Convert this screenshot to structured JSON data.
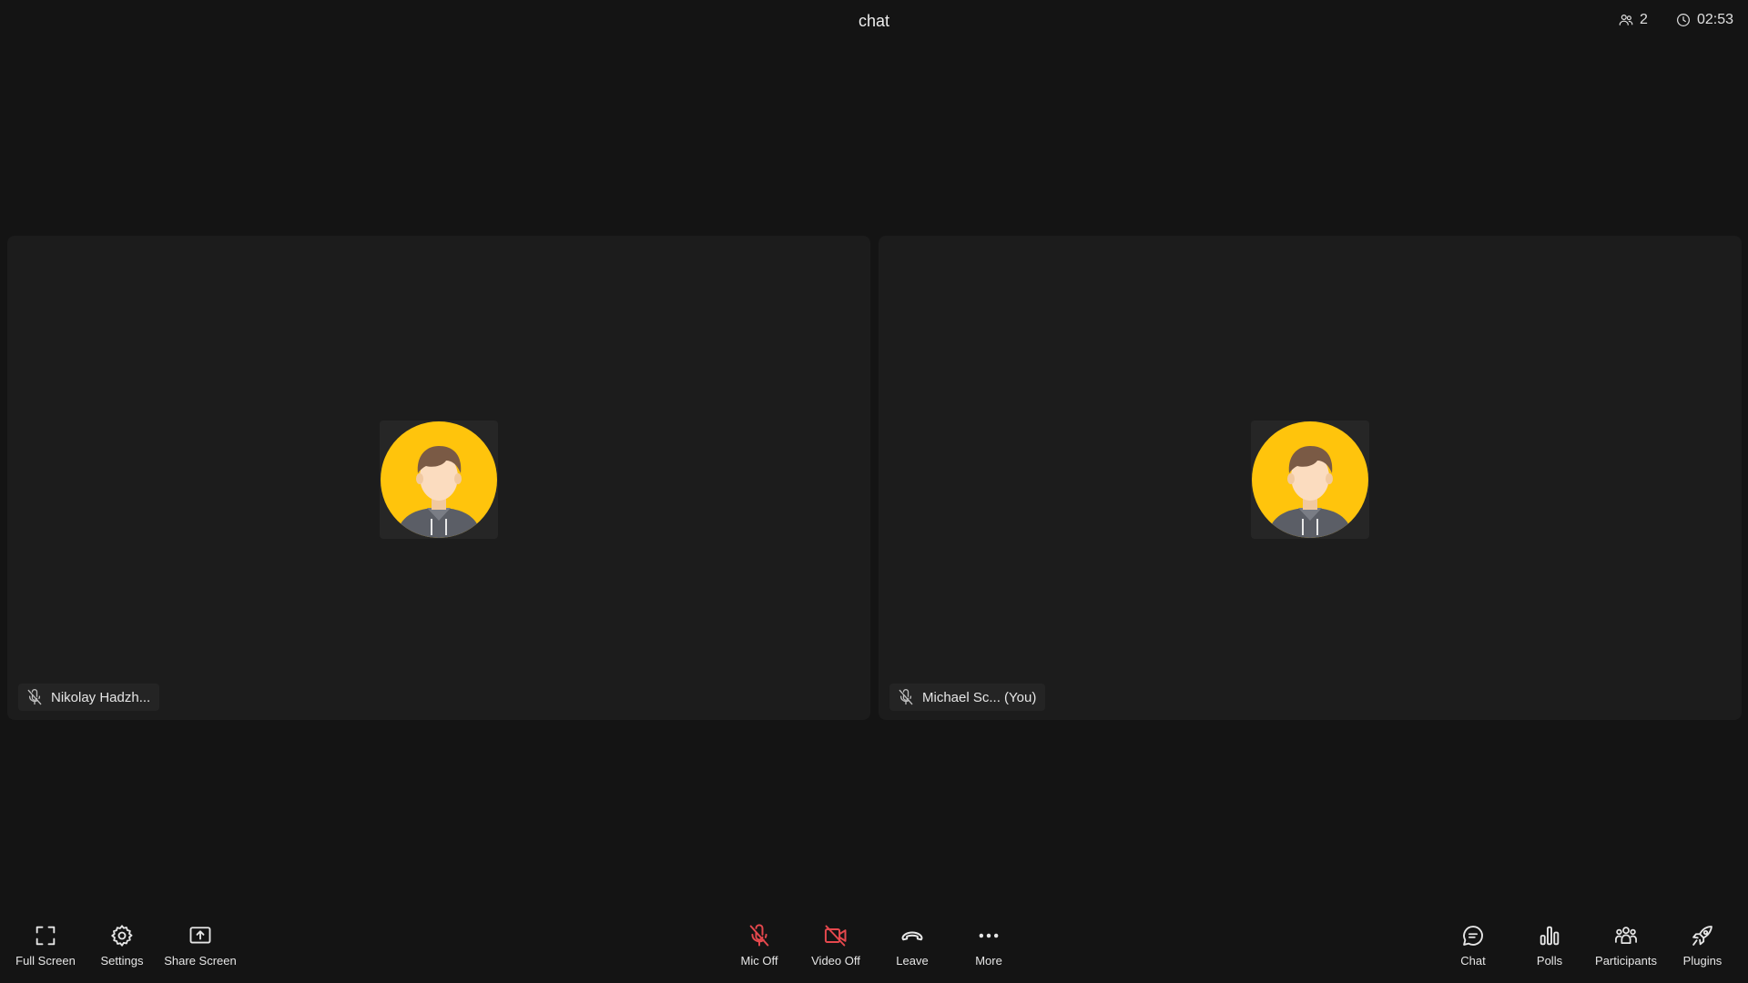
{
  "header": {
    "title": "chat",
    "participant_count": "2",
    "timer": "02:53"
  },
  "tiles": [
    {
      "name": "Nikolay Hadzh...",
      "mic": "muted"
    },
    {
      "name": "Michael Sc... (You)",
      "mic": "muted"
    }
  ],
  "toolbar": {
    "left": [
      {
        "label": "Full Screen",
        "icon": "fullscreen-icon"
      },
      {
        "label": "Settings",
        "icon": "gear-icon"
      },
      {
        "label": "Share Screen",
        "icon": "share-screen-icon"
      }
    ],
    "center": [
      {
        "label": "Mic Off",
        "icon": "mic-off-icon"
      },
      {
        "label": "Video Off",
        "icon": "video-off-icon"
      },
      {
        "label": "Leave",
        "icon": "phone-hangup-icon"
      },
      {
        "label": "More",
        "icon": "ellipsis-icon"
      }
    ],
    "right": [
      {
        "label": "Chat",
        "icon": "chat-bubble-icon"
      },
      {
        "label": "Polls",
        "icon": "bar-chart-icon"
      },
      {
        "label": "Participants",
        "icon": "participants-icon"
      },
      {
        "label": "Plugins",
        "icon": "rocket-icon"
      }
    ]
  },
  "colors": {
    "background": "#141414",
    "tile": "#1c1c1c",
    "danger": "#e5484d",
    "avatar_bg": "#ffc40c"
  }
}
